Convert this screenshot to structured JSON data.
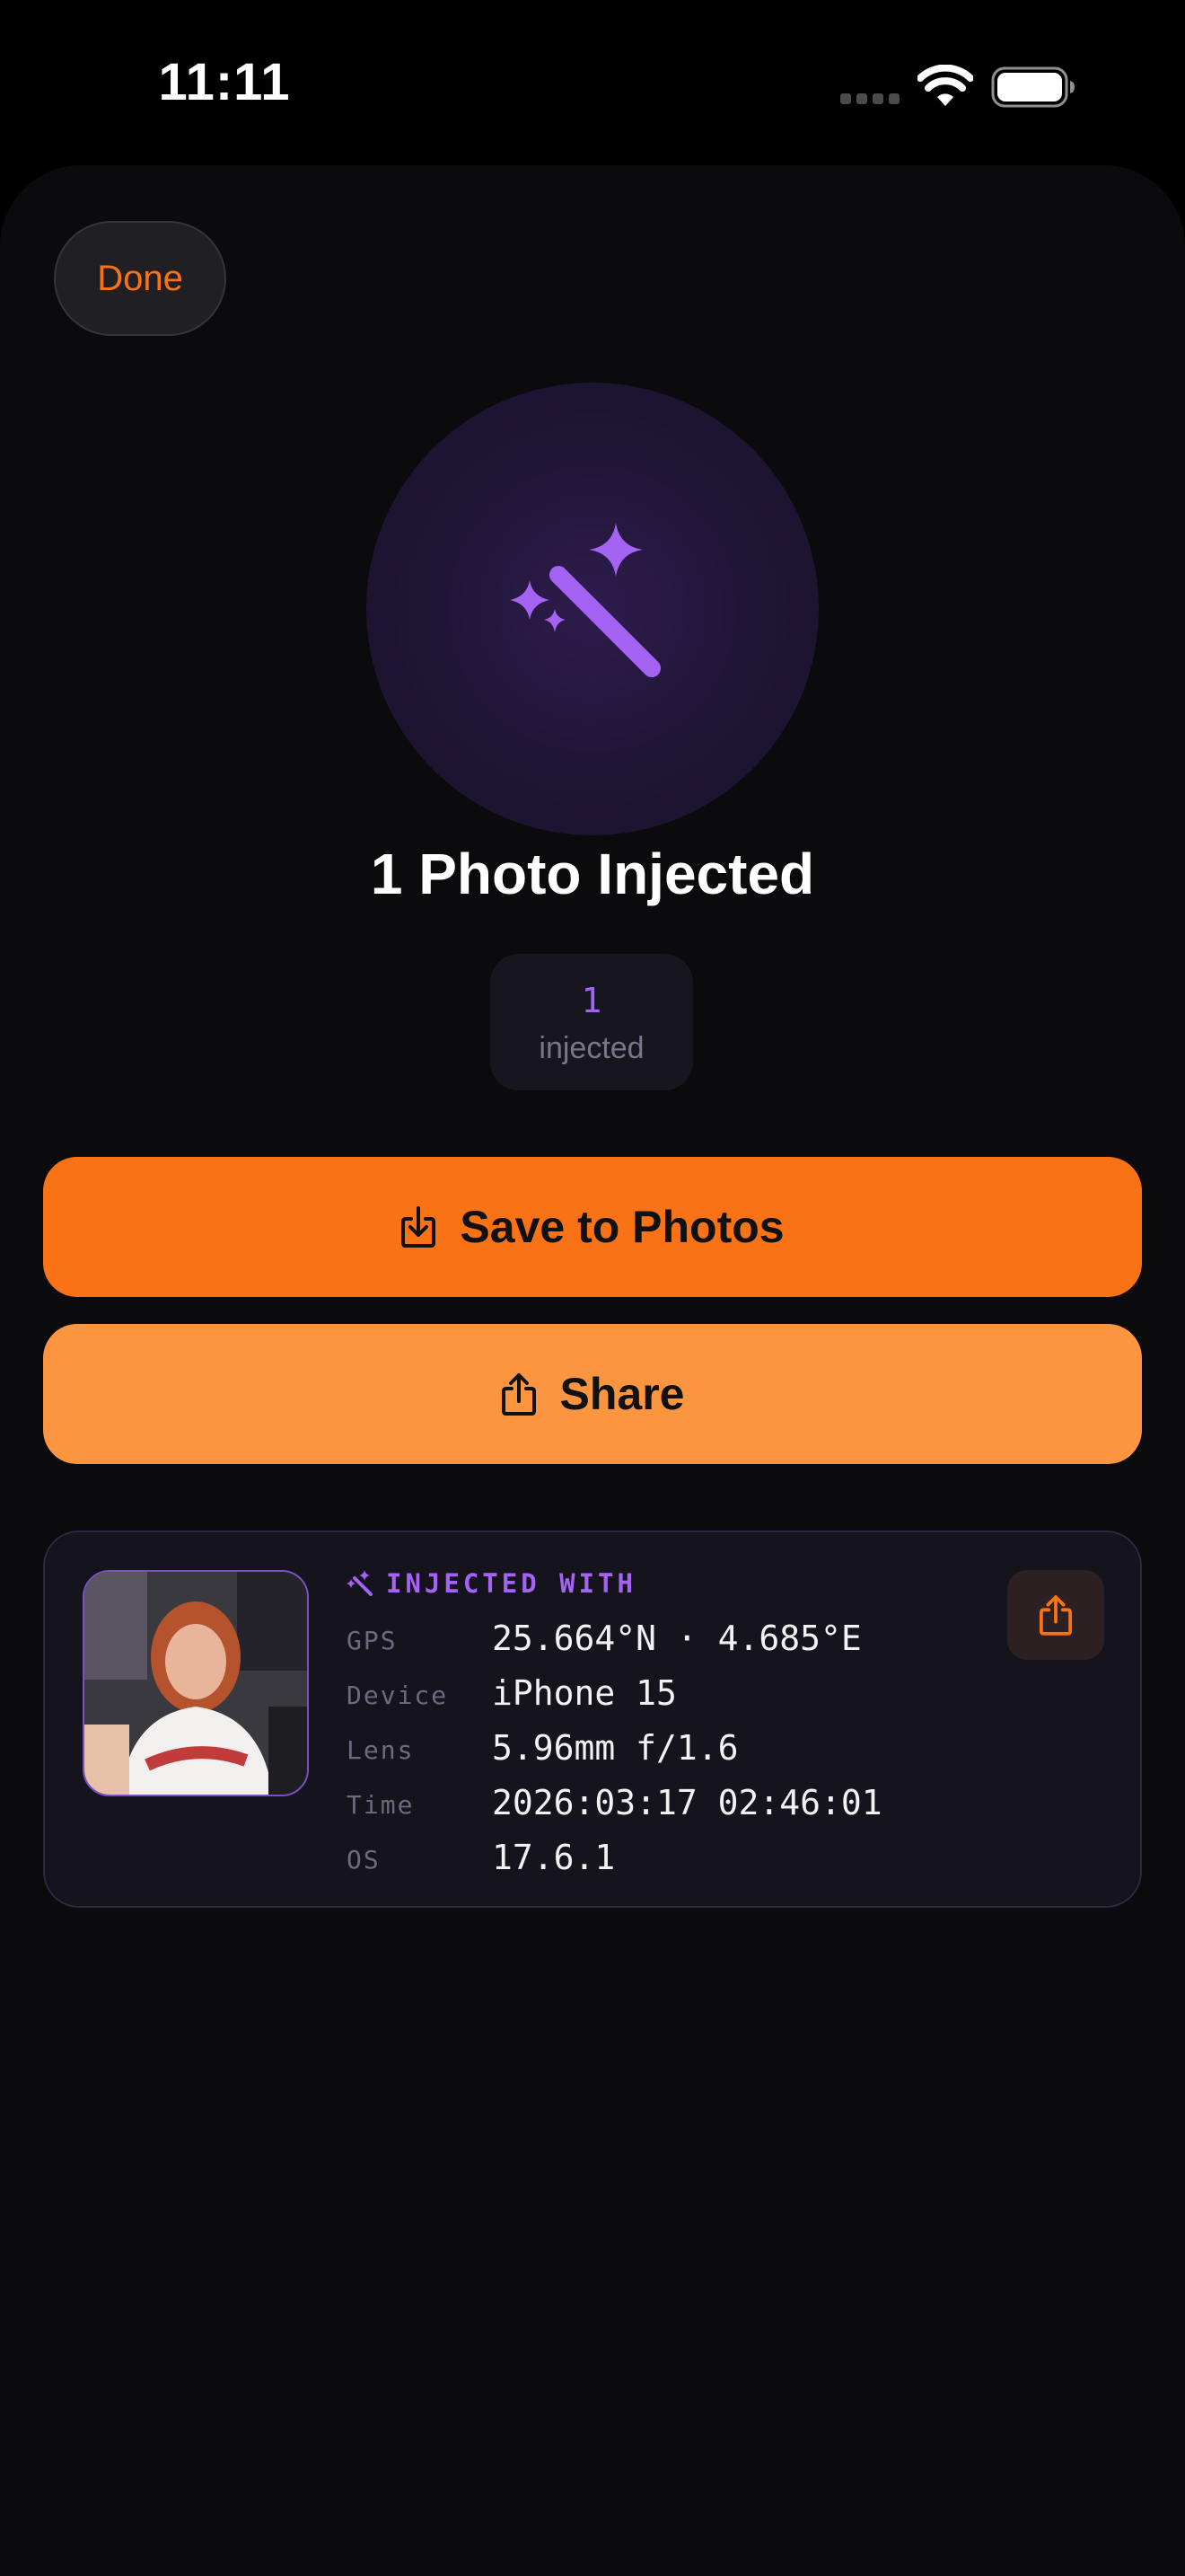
{
  "status_bar": {
    "time": "11:11",
    "icons": [
      "signal-icon",
      "wifi-icon",
      "battery-icon"
    ]
  },
  "sheet": {
    "done_label": "Done",
    "title": "1 Photo Injected",
    "hero_icon": "magic-wand-icon",
    "count": {
      "value": "1",
      "label": "injected"
    },
    "actions": {
      "save_label": "Save to Photos",
      "save_icon": "save-to-photos-icon",
      "share_label": "Share",
      "share_icon": "share-icon"
    }
  },
  "detail_card": {
    "header_icon": "magic-wand-icon",
    "header_label": "INJECTED WITH",
    "thumbnail": "photo-thumbnail",
    "rows": [
      {
        "key": "GPS",
        "value": "25.664°N · 4.685°E"
      },
      {
        "key": "Device",
        "value": "iPhone 15"
      },
      {
        "key": "Lens",
        "value": "5.96mm f/1.6"
      },
      {
        "key": "Time",
        "value": "2026:03:17 02:46:01"
      },
      {
        "key": "OS",
        "value": "17.6.1"
      }
    ],
    "share_icon": "share-icon"
  },
  "colors": {
    "accent_orange": "#f97316",
    "accent_orange_light": "#fb953f",
    "accent_purple": "#a463f2",
    "background": "#0b0b0e",
    "card_background": "#15141d"
  }
}
